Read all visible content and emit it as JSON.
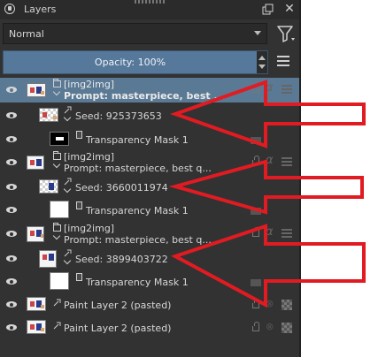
{
  "panel": {
    "title": "Layers",
    "close_glyph": "✕"
  },
  "blend_mode": {
    "value": "Normal"
  },
  "opacity": {
    "label": "Opacity:",
    "value": "100%",
    "text": "Opacity:  100%"
  },
  "layers": [
    {
      "type": "group",
      "name_line1": "[img2img]",
      "name_line2": "Prompt: masterpiece, best ...",
      "selected": true
    },
    {
      "type": "paint",
      "name": "Seed: 925373653"
    },
    {
      "type": "mask",
      "name": "Transparency Mask 1"
    },
    {
      "type": "group",
      "name_line1": "[img2img]",
      "name_line2": "Prompt: masterpiece, best q..."
    },
    {
      "type": "paint",
      "name": "Seed: 3660011974"
    },
    {
      "type": "mask",
      "name": "Transparency Mask 1"
    },
    {
      "type": "group",
      "name_line1": "[img2img]",
      "name_line2": "Prompt: masterpiece, best q..."
    },
    {
      "type": "paint",
      "name": "Seed: 3899403722"
    },
    {
      "type": "mask",
      "name": "Transparency Mask 1"
    },
    {
      "type": "paint-root",
      "name": "Paint Layer 2 (pasted)"
    },
    {
      "type": "paint-root",
      "name": "Paint Layer 2 (pasted)"
    }
  ],
  "annotation_color": "#e11b22",
  "icons": {
    "visibility": "eye-icon",
    "group": "folder-icon",
    "lock": "lock-icon",
    "alpha": "alpha-lock-icon",
    "inherit": "inherit-alpha-icon"
  }
}
